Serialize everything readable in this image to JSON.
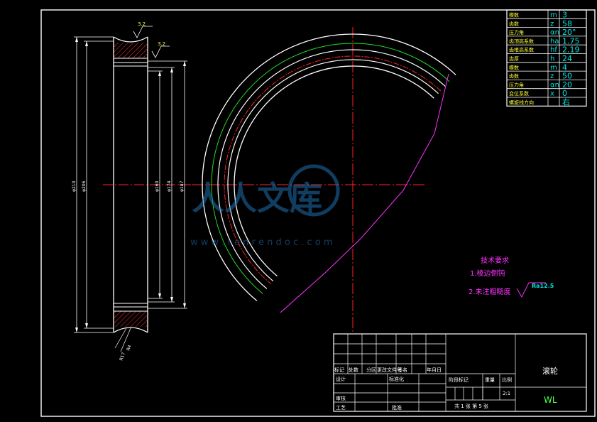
{
  "param_table": [
    {
      "name": "模数",
      "sym": "m",
      "val": "3"
    },
    {
      "name": "齿数",
      "sym": "z",
      "val": "58"
    },
    {
      "name": "压力角",
      "sym": "αn",
      "val": "20°"
    },
    {
      "name": "齿顶高系数",
      "sym": "ha",
      "val": "1.75"
    },
    {
      "name": "齿根高系数",
      "sym": "hf",
      "val": "2.19"
    },
    {
      "name": "齿厚",
      "sym": "h",
      "val": "24"
    },
    {
      "name": "模数",
      "sym": "m",
      "val": "4"
    },
    {
      "name": "齿数",
      "sym": "z",
      "val": "50"
    },
    {
      "name": "压力角",
      "sym": "αn",
      "val": "20"
    },
    {
      "name": "变位系数",
      "sym": "x",
      "val": "0"
    },
    {
      "name": "螺旋线方向",
      "sym": "",
      "val": "右"
    }
  ],
  "section_dims": {
    "d1": "φ210",
    "d2": "φ206",
    "d3": "φ160",
    "d4": "φ174",
    "d5": "φ187",
    "r1": "3.2",
    "r2": "3.2",
    "r3": "R17",
    "r4": "R4"
  },
  "tech_req": {
    "title": "技术要求",
    "item1": "1.棱边倒钝",
    "item2": "2.未注粗糙度",
    "roughness": "Ra12.5"
  },
  "watermark": {
    "text": "人人文库",
    "url": "w w w . r e n r e n d o c . c o m"
  },
  "title_block": {
    "row_labels": [
      "标记",
      "处数",
      "分区",
      "更改文件号",
      "签名",
      "年月日"
    ],
    "design": "设计",
    "standardize": "标准化",
    "stage_mark": "阶段标记",
    "weight": "重量",
    "scale": "比例",
    "scale_value": "2:1",
    "review": "审核",
    "process": "工艺",
    "approve": "批准",
    "sheets": "共 1 张  第 5 张",
    "part_name": "滚轮",
    "drawing_no": "WL"
  },
  "colors": {
    "outline": "#ffffff",
    "green": "#22dd22",
    "red": "#ff2222",
    "magenta": "#ff33ff",
    "cyan": "#00e5e5",
    "yellow": "#ffff33"
  }
}
